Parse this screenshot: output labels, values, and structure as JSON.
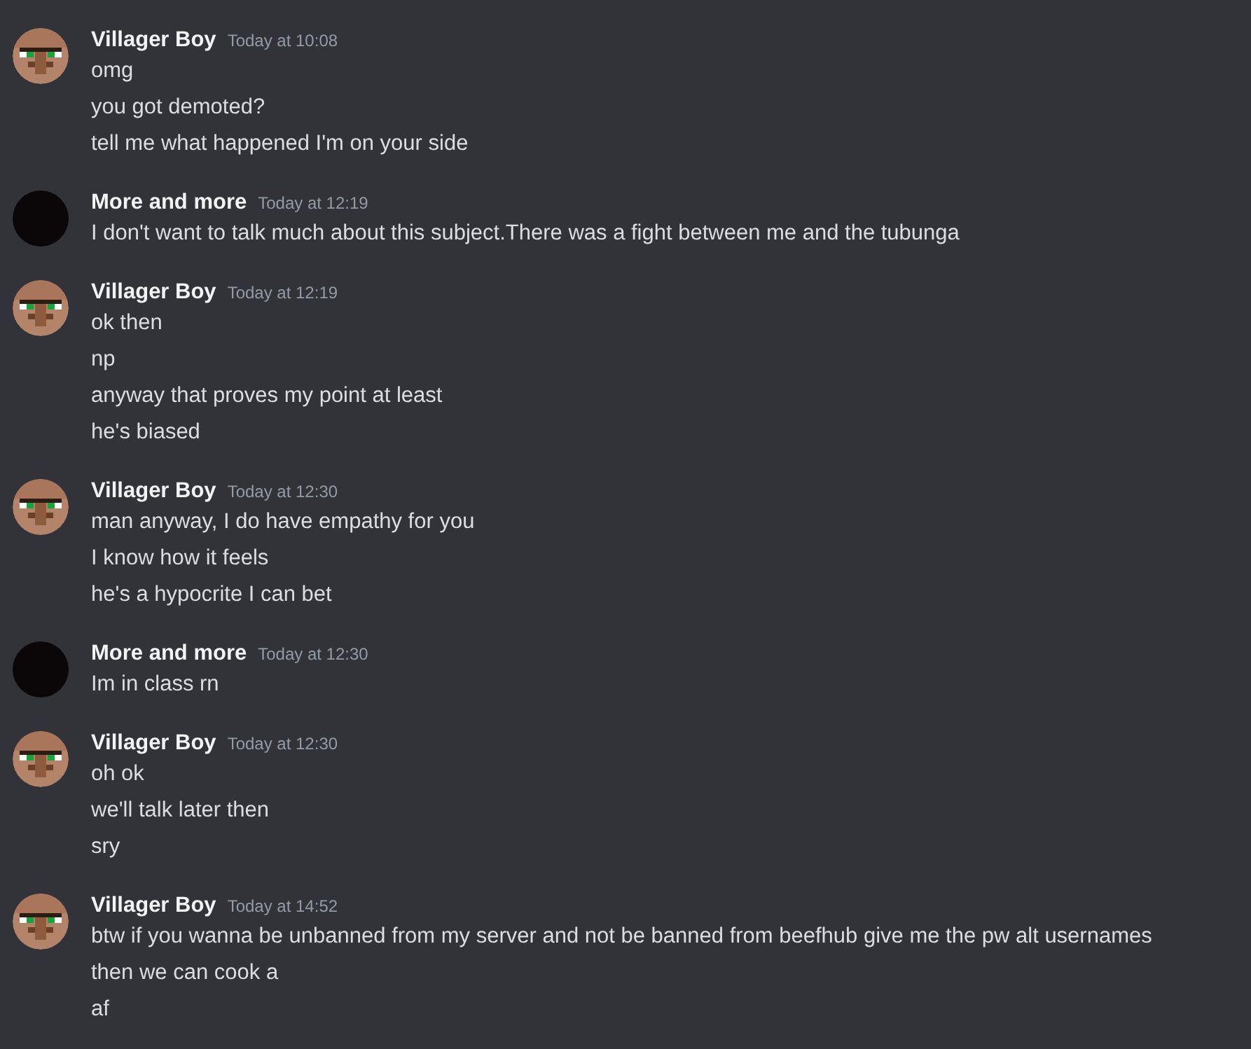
{
  "messages": [
    {
      "author": "Villager Boy",
      "kind": "villager",
      "time": "Today at 10:08",
      "lines": [
        "omg",
        "you got demoted?",
        "tell me what happened I'm on your side"
      ]
    },
    {
      "author": "More and more",
      "kind": "dark",
      "time": "Today at 12:19",
      "lines": [
        "I don't want to talk much about this subject.There was a fight between me and the tubunga"
      ]
    },
    {
      "author": "Villager Boy",
      "kind": "villager",
      "time": "Today at 12:19",
      "lines": [
        "ok then",
        "np",
        "anyway that proves my point at least",
        "he's biased"
      ]
    },
    {
      "author": "Villager Boy",
      "kind": "villager",
      "time": "Today at 12:30",
      "lines": [
        "man anyway, I do have empathy for you",
        "I know how it feels",
        "he's a hypocrite I can bet"
      ]
    },
    {
      "author": "More and more",
      "kind": "dark",
      "time": "Today at 12:30",
      "lines": [
        "Im in class rn"
      ]
    },
    {
      "author": "Villager Boy",
      "kind": "villager",
      "time": "Today at 12:30",
      "lines": [
        "oh ok",
        "we'll talk later then",
        "sry"
      ]
    },
    {
      "author": "Villager Boy",
      "kind": "villager",
      "time": "Today at 14:52",
      "lines": [
        "btw if you wanna be unbanned from my server and not be banned from beefhub give me the pw alt usernames",
        "then we can cook a",
        "af"
      ]
    }
  ]
}
